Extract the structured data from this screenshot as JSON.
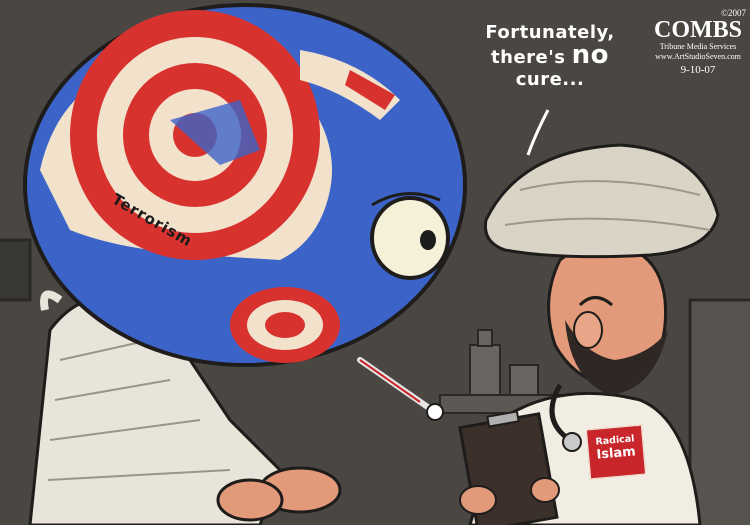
{
  "speech": {
    "line1": "Fortunately,",
    "line2": "there's",
    "emphasis": "no",
    "line3": "cure..."
  },
  "credit": {
    "copyright": "©2007",
    "artist": "COMBS",
    "syndicate": "Tribune Media Services",
    "website": "www.ArtStudioSeven.com",
    "date": "9-10-07"
  },
  "globe": {
    "label": "Terrorism"
  },
  "doctor": {
    "badge_line1": "Radical",
    "badge_line2": "Islam"
  },
  "colors": {
    "background": "#4a4743",
    "ocean": "#3c64c8",
    "target_red": "#d8322f",
    "target_cream": "#f2e2cc",
    "turban": "#d9d4c6"
  }
}
